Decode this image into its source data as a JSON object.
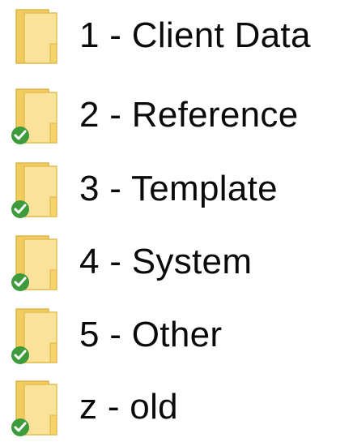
{
  "folders": [
    {
      "name": "1 - Client Data",
      "icon": "folder-icon",
      "sync_status": "none"
    },
    {
      "name": "2 - Reference",
      "icon": "folder-icon",
      "sync_status": "synced"
    },
    {
      "name": "3 - Template",
      "icon": "folder-icon",
      "sync_status": "synced"
    },
    {
      "name": "4 - System",
      "icon": "folder-icon",
      "sync_status": "synced"
    },
    {
      "name": "5 - Other",
      "icon": "folder-icon",
      "sync_status": "synced"
    },
    {
      "name": "z - old",
      "icon": "folder-icon",
      "sync_status": "synced"
    }
  ],
  "colors": {
    "folder_body": "#F6D46B",
    "folder_front": "#FBE29A",
    "folder_edge": "#D9B54A",
    "synced_check": "#3E9B3B",
    "text": "#0A0A0A"
  }
}
